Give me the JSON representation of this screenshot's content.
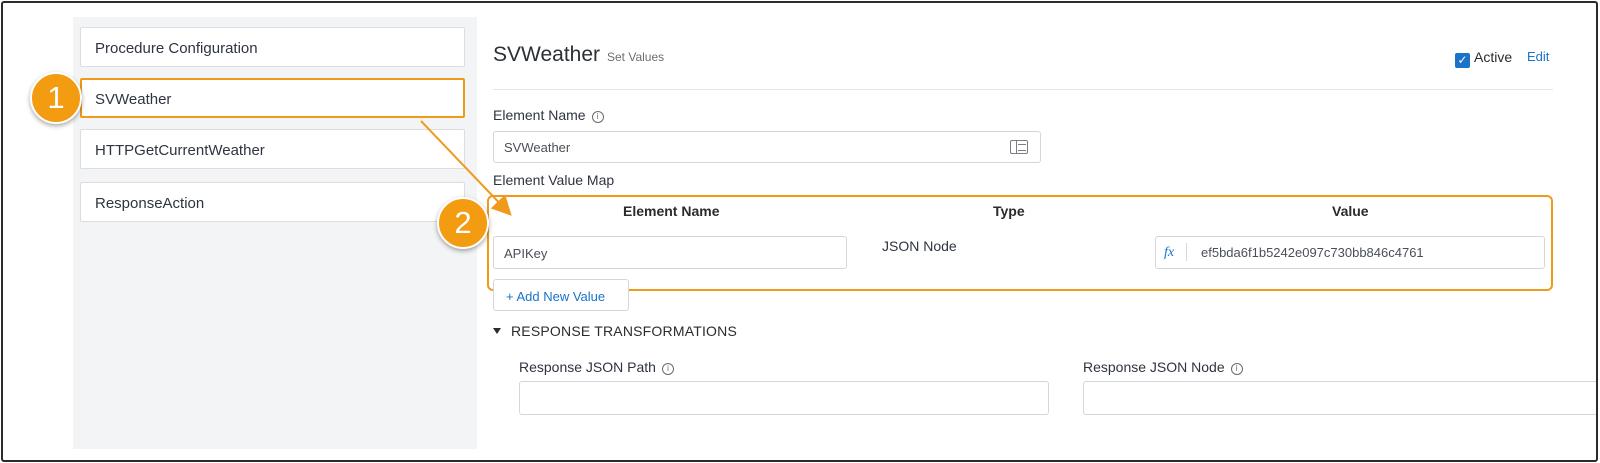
{
  "sidebar": {
    "items": [
      {
        "label": "Procedure Configuration"
      },
      {
        "label": "SVWeather"
      },
      {
        "label": "HTTPGetCurrentWeather"
      },
      {
        "label": "ResponseAction"
      }
    ]
  },
  "callouts": [
    "1",
    "2"
  ],
  "header": {
    "title": "SVWeather",
    "subtitle": "Set Values",
    "active_label": "Active",
    "active_checked": true,
    "edit_label": "Edit"
  },
  "form": {
    "element_name_label": "Element Name",
    "element_name_value": "SVWeather",
    "value_map_label": "Element Value Map",
    "columns": [
      "Element Name",
      "Type",
      "Value"
    ],
    "rows": [
      {
        "element_name": "APIKey",
        "type": "JSON Node",
        "value": "ef5bda6f1b5242e097c730bb846c4761"
      }
    ],
    "fx_label": "fx",
    "add_value_label": "+ Add New Value"
  },
  "response_transformations": {
    "heading": "RESPONSE TRANSFORMATIONS",
    "json_path_label": "Response JSON Path",
    "json_path_value": "",
    "json_node_label": "Response JSON Node",
    "json_node_value": ""
  },
  "colors": {
    "accent": "#f09a1c",
    "link": "#1a73c9"
  }
}
